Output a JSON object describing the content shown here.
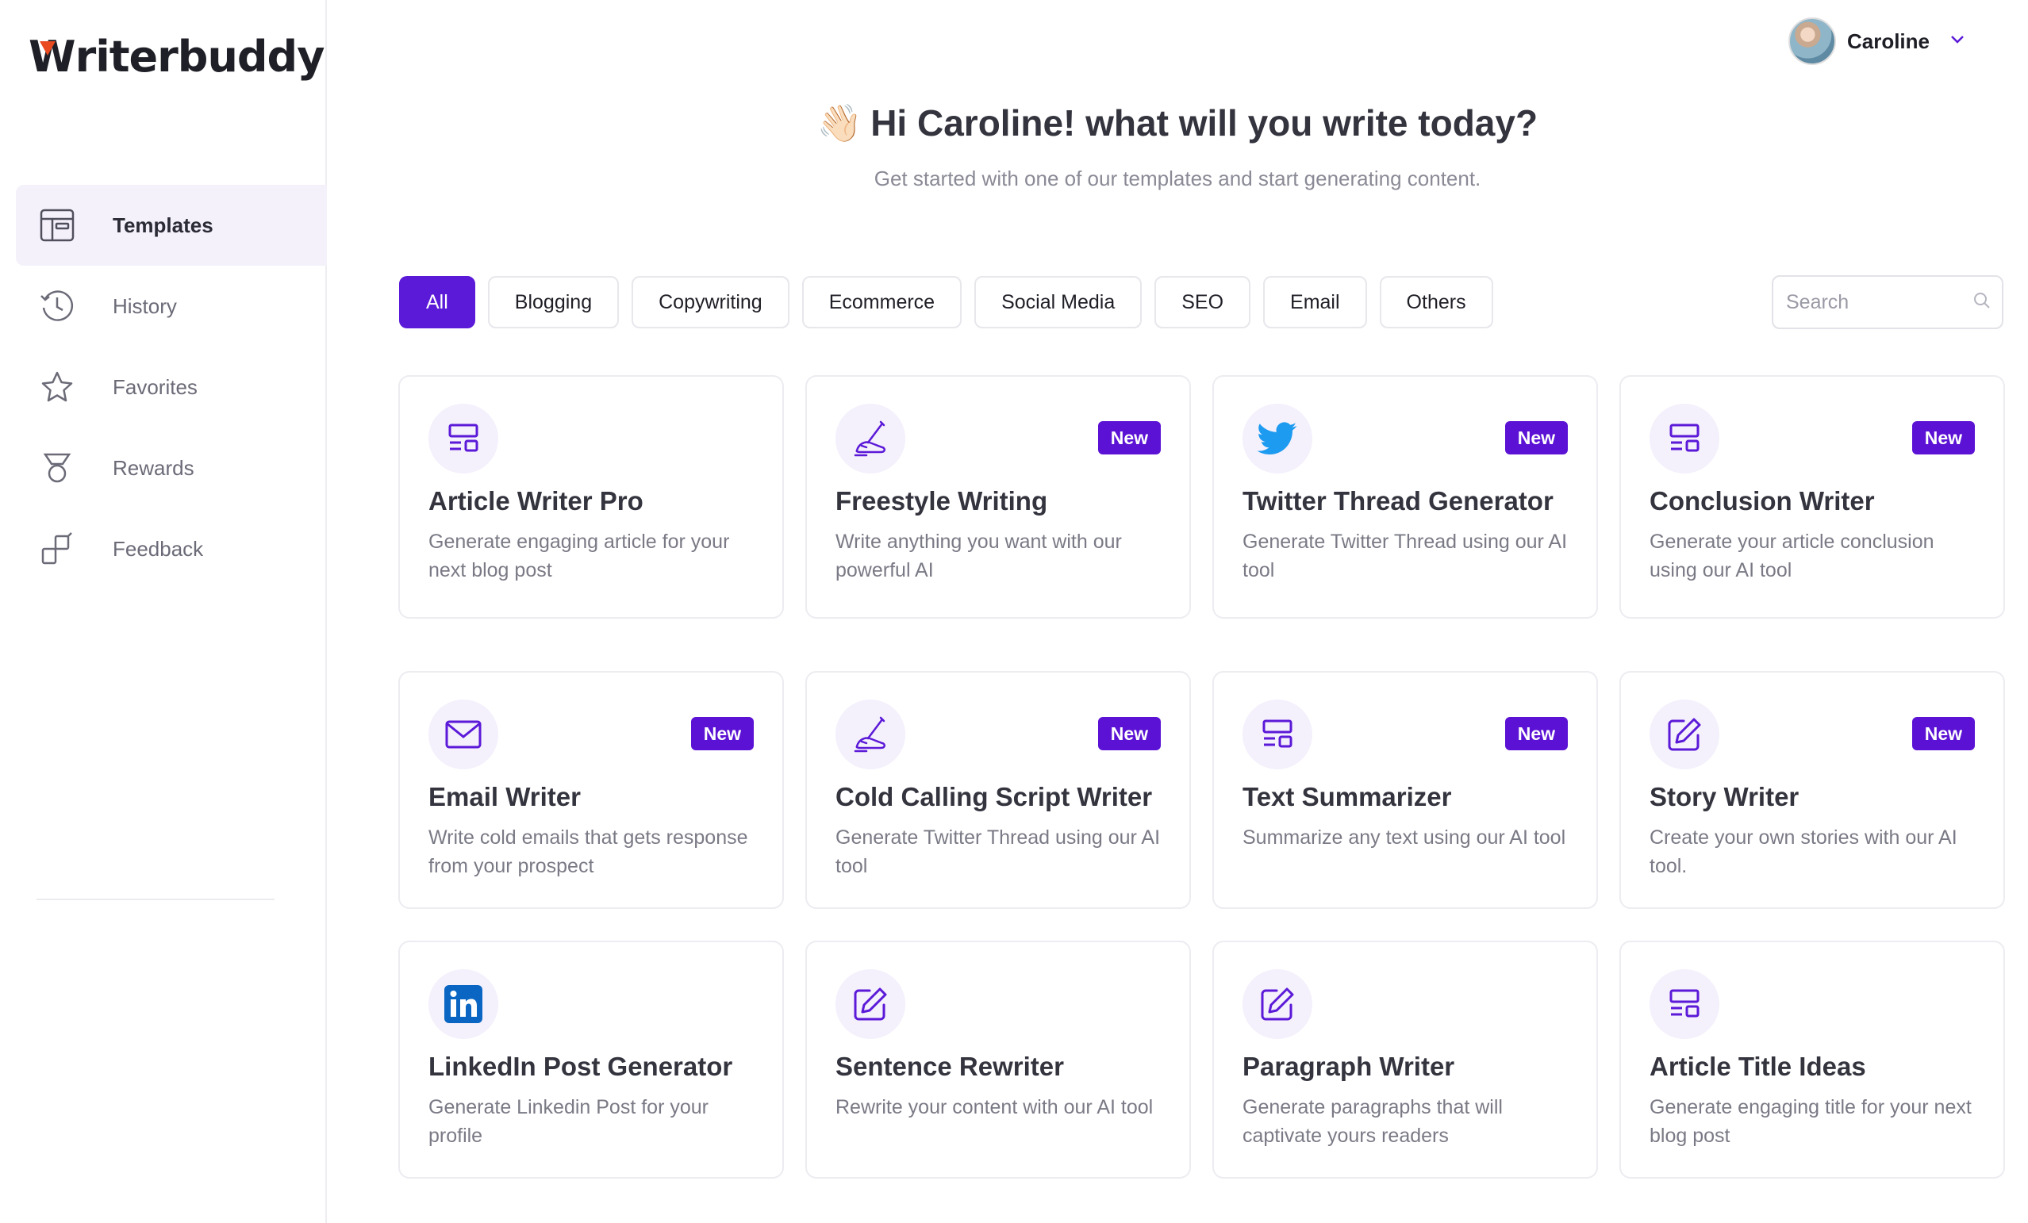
{
  "brand": {
    "name_initial": "W",
    "name_rest": "riterbuddy",
    "accent": "#5b19d8",
    "logo_mark_color": "#ea4a1f"
  },
  "sidebar": {
    "items": [
      {
        "label": "Templates",
        "icon": "layout-icon",
        "active": true
      },
      {
        "label": "History",
        "icon": "history-icon",
        "active": false
      },
      {
        "label": "Favorites",
        "icon": "star-icon",
        "active": false
      },
      {
        "label": "Rewards",
        "icon": "medal-icon",
        "active": false
      },
      {
        "label": "Feedback",
        "icon": "feedback-icon",
        "active": false
      }
    ]
  },
  "user": {
    "name": "Caroline",
    "avatar_icon": "avatar",
    "menu_icon": "chevron-down-icon"
  },
  "header": {
    "greeting_emoji": "👋🏻",
    "greeting": "Hi Caroline! what will you write today?",
    "subtitle": "Get started with one of our templates and start generating content."
  },
  "filters": {
    "chips": [
      "All",
      "Blogging",
      "Copywriting",
      "Ecommerce",
      "Social Media",
      "SEO",
      "Email",
      "Others"
    ],
    "active": "All"
  },
  "search": {
    "placeholder": "Search",
    "value": ""
  },
  "cards": [
    {
      "title": "Article Writer Pro",
      "desc": "Generate engaging article for your next blog post",
      "icon": "template-icon",
      "badge": ""
    },
    {
      "title": "Freestyle Writing",
      "desc": "Write anything you want with our powerful AI",
      "icon": "hand-pen-icon",
      "badge": "New"
    },
    {
      "title": "Twitter Thread Generator",
      "desc": "Generate Twitter Thread using our AI tool",
      "icon": "twitter-icon",
      "badge": "New"
    },
    {
      "title": "Conclusion Writer",
      "desc": "Generate your article conclusion using our AI tool",
      "icon": "template-icon",
      "badge": "New"
    },
    {
      "title": "Email Writer",
      "desc": "Write cold emails that gets response from your prospect",
      "icon": "envelope-icon",
      "badge": "New"
    },
    {
      "title": "Cold Calling Script Writer",
      "desc": "Generate Twitter Thread using our AI tool",
      "icon": "hand-pen-icon",
      "badge": "New"
    },
    {
      "title": "Text Summarizer",
      "desc": "Summarize any text using our AI tool",
      "icon": "template-icon",
      "badge": "New"
    },
    {
      "title": "Story Writer",
      "desc": "Create your own stories with our AI tool.",
      "icon": "edit-icon",
      "badge": "New"
    },
    {
      "title": "LinkedIn Post Generator",
      "desc": "Generate Linkedin Post for your profile",
      "icon": "linkedin-icon",
      "badge": ""
    },
    {
      "title": "Sentence Rewriter",
      "desc": "Rewrite your content with our AI tool",
      "icon": "edit-icon",
      "badge": ""
    },
    {
      "title": "Paragraph Writer",
      "desc": "Generate paragraphs that will captivate yours readers",
      "icon": "edit-icon",
      "badge": ""
    },
    {
      "title": "Article Title Ideas",
      "desc": "Generate engaging title for your next blog post",
      "icon": "template-icon",
      "badge": ""
    }
  ]
}
